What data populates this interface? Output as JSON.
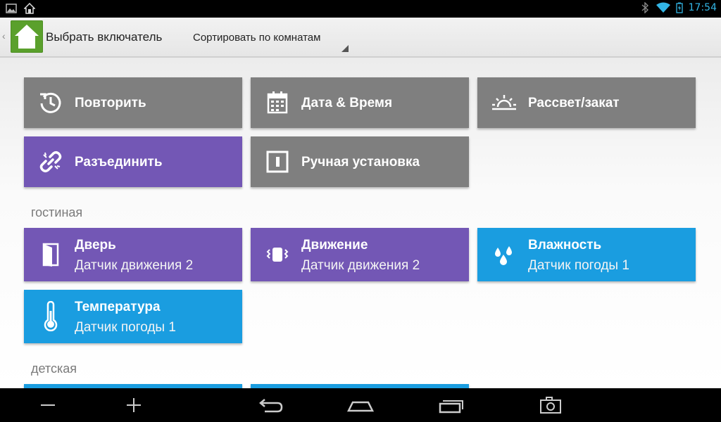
{
  "status": {
    "time": "17:54"
  },
  "actionbar": {
    "title": "Выбрать включатель",
    "spinner": "Сортировать по комнатам"
  },
  "general_tiles": [
    {
      "title": "Повторить",
      "icon": "repeat-icon",
      "color": "#7f7f7f"
    },
    {
      "title": "Дата & Время",
      "icon": "calendar-icon",
      "color": "#7f7f7f"
    },
    {
      "title": "Рассвет/закат",
      "icon": "sunrise-icon",
      "color": "#7f7f7f"
    },
    {
      "title": "Разъединить",
      "icon": "unlink-icon",
      "color": "#7357b5"
    },
    {
      "title": "Ручная установка",
      "icon": "manual-switch-icon",
      "color": "#7f7f7f"
    }
  ],
  "rooms": [
    {
      "name": "гостиная",
      "tiles": [
        {
          "title": "Дверь",
          "subtitle": "Датчик движения 2",
          "icon": "door-icon",
          "color": "#7357b5"
        },
        {
          "title": "Движение",
          "subtitle": "Датчик движения 2",
          "icon": "motion-icon",
          "color": "#7357b5"
        },
        {
          "title": "Влажность",
          "subtitle": "Датчик погоды 1",
          "icon": "humidity-icon",
          "color": "#1a9de0"
        },
        {
          "title": "Температура",
          "subtitle": "Датчик погоды 1",
          "icon": "thermometer-icon",
          "color": "#1a9de0"
        }
      ]
    },
    {
      "name": "детская",
      "tiles": [
        {
          "title": "",
          "subtitle": "",
          "color": "#1a9de0"
        },
        {
          "title": "",
          "subtitle": "",
          "color": "#1a9de0"
        }
      ]
    }
  ],
  "navbar": [
    "minus-icon",
    "plus-icon",
    "back-icon",
    "home-icon",
    "recents-icon",
    "screenshot-icon"
  ]
}
